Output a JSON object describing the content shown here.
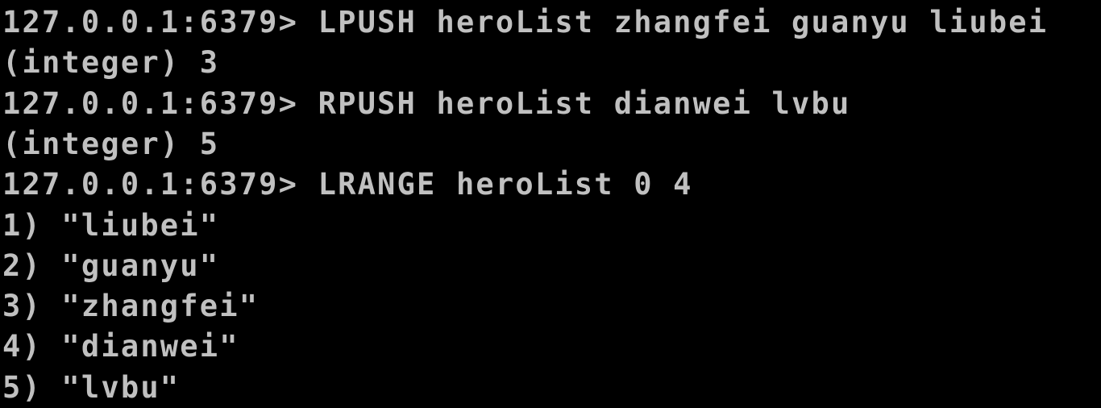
{
  "console": {
    "lines": [
      "127.0.0.1:6379> LPUSH heroList zhangfei guanyu liubei",
      "(integer) 3",
      "127.0.0.1:6379> RPUSH heroList dianwei lvbu",
      "(integer) 5",
      "127.0.0.1:6379> LRANGE heroList 0 4",
      "1) \"liubei\"",
      "2) \"guanyu\"",
      "3) \"zhangfei\"",
      "4) \"dianwei\"",
      "5) \"lvbu\""
    ],
    "colors": {
      "background": "#000000",
      "text": "#c0c0c0"
    }
  }
}
